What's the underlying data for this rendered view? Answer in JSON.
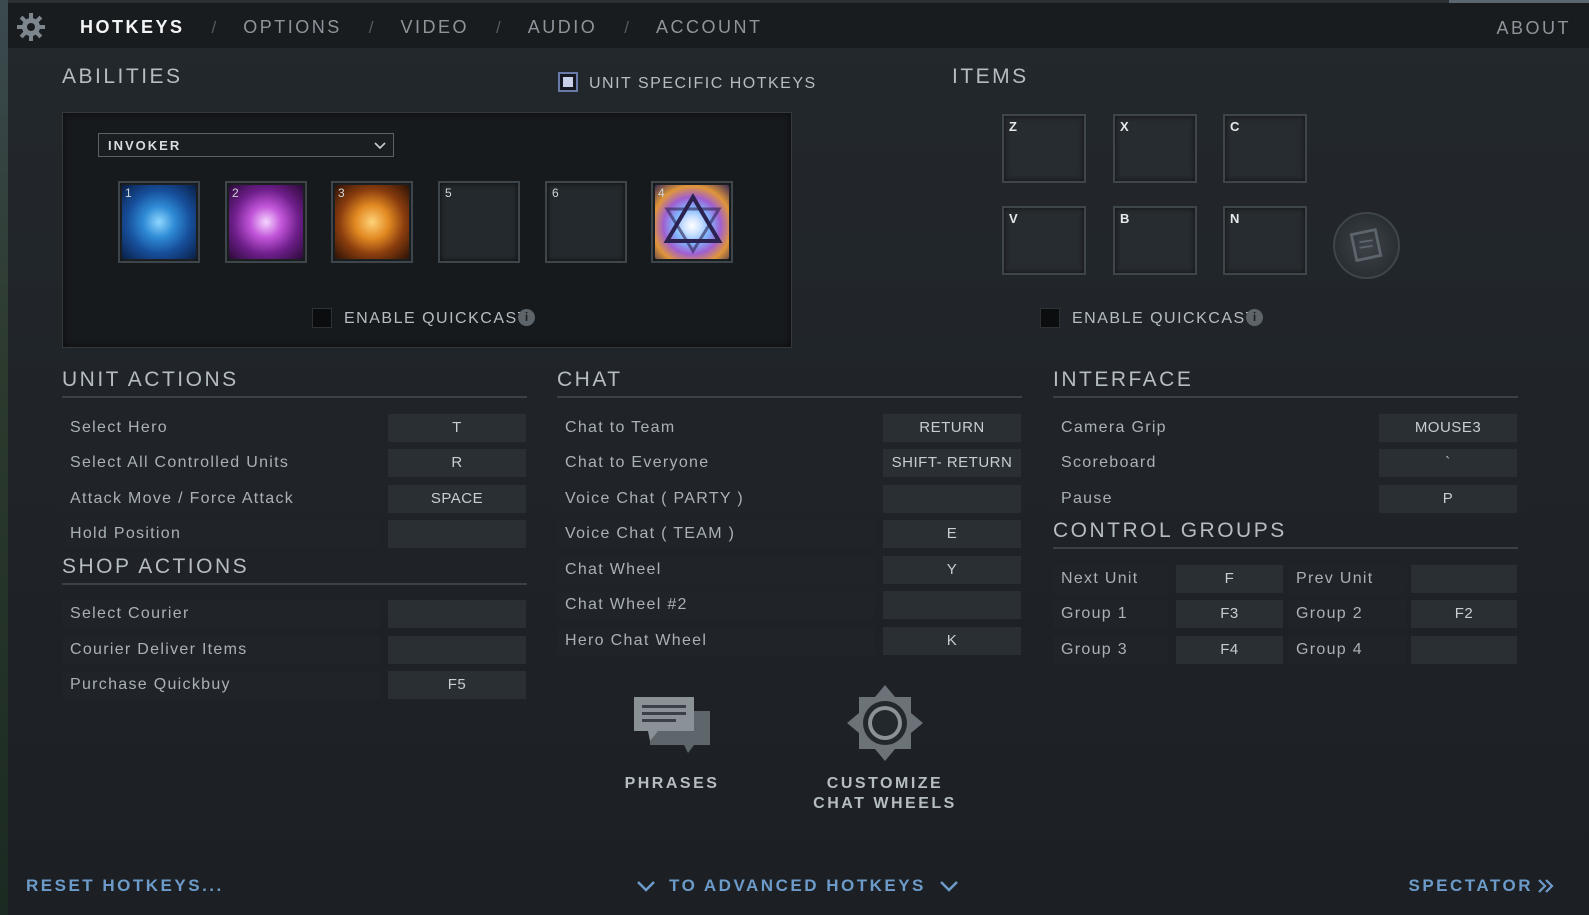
{
  "nav": {
    "tabs": [
      {
        "label": "HOTKEYS",
        "active": true
      },
      {
        "label": "OPTIONS",
        "active": false
      },
      {
        "label": "VIDEO",
        "active": false
      },
      {
        "label": "AUDIO",
        "active": false
      },
      {
        "label": "ACCOUNT",
        "active": false
      }
    ],
    "separator": "/",
    "about": "ABOUT"
  },
  "abilities": {
    "title": "ABILITIES",
    "unit_specific_label": "UNIT SPECIFIC HOTKEYS",
    "hero_dropdown_value": "INVOKER",
    "slots": [
      {
        "num": "1",
        "icon": "quas-orb-icon"
      },
      {
        "num": "2",
        "icon": "wex-orb-icon"
      },
      {
        "num": "3",
        "icon": "exort-orb-icon"
      },
      {
        "num": "5",
        "icon": ""
      },
      {
        "num": "6",
        "icon": ""
      },
      {
        "num": "4",
        "icon": "invoke-icon"
      }
    ],
    "quickcast_label": "ENABLE QUICKCAST"
  },
  "items": {
    "title": "ITEMS",
    "slots": [
      "Z",
      "X",
      "C",
      "V",
      "B",
      "N"
    ],
    "quickcast_label": "ENABLE QUICKCAST"
  },
  "unit_actions": {
    "title": "UNIT ACTIONS",
    "rows": [
      {
        "label": "Select Hero",
        "key": "T"
      },
      {
        "label": "Select All Controlled Units",
        "key": "R"
      },
      {
        "label": "Attack Move / Force Attack",
        "key": "SPACE"
      },
      {
        "label": "Hold Position",
        "key": ""
      }
    ]
  },
  "shop_actions": {
    "title": "SHOP ACTIONS",
    "rows": [
      {
        "label": "Select Courier",
        "key": ""
      },
      {
        "label": "Courier Deliver Items",
        "key": ""
      },
      {
        "label": "Purchase Quickbuy",
        "key": "F5"
      }
    ]
  },
  "chat": {
    "title": "CHAT",
    "rows": [
      {
        "label": "Chat to Team",
        "key": "RETURN"
      },
      {
        "label": "Chat to Everyone",
        "key": "SHIFT- RETURN"
      },
      {
        "label": "Voice Chat ( PARTY )",
        "key": ""
      },
      {
        "label": "Voice Chat ( TEAM )",
        "key": "E"
      },
      {
        "label": "Chat Wheel",
        "key": "Y"
      },
      {
        "label": "Chat Wheel #2",
        "key": ""
      },
      {
        "label": "Hero Chat Wheel",
        "key": "K"
      }
    ],
    "phrases_label": "PHRASES",
    "customize_label_1": "CUSTOMIZE",
    "customize_label_2": "CHAT WHEELS"
  },
  "interface": {
    "title": "INTERFACE",
    "rows": [
      {
        "label": "Camera Grip",
        "key": "MOUSE3"
      },
      {
        "label": "Scoreboard",
        "key": "`"
      },
      {
        "label": "Pause",
        "key": "P"
      }
    ]
  },
  "control_groups": {
    "title": "CONTROL GROUPS",
    "rows": [
      {
        "l1": "Next Unit",
        "k1": "F",
        "l2": "Prev Unit",
        "k2": ""
      },
      {
        "l1": "Group 1",
        "k1": "F3",
        "l2": "Group 2",
        "k2": "F2"
      },
      {
        "l1": "Group 3",
        "k1": "F4",
        "l2": "Group 4",
        "k2": ""
      }
    ]
  },
  "footer": {
    "reset": "RESET HOTKEYS...",
    "advanced": "TO ADVANCED HOTKEYS",
    "spectator": "SPECTATOR"
  },
  "colors": {
    "accent_link": "#6d9bc9",
    "background": "#1e2226"
  }
}
